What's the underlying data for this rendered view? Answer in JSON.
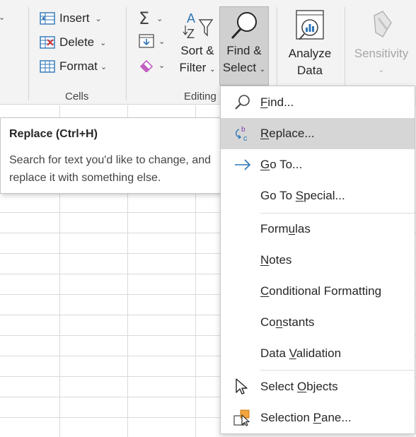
{
  "ribbon": {
    "cells_group": {
      "label": "Cells",
      "insert": "Insert",
      "delete": "Delete",
      "format": "Format"
    },
    "editing_group": {
      "label": "Editing",
      "autosum_icon": "sigma-icon",
      "fill_icon": "fill-down-icon",
      "clear_icon": "eraser-icon",
      "sort_filter_line1": "Sort &",
      "sort_filter_line2": "Filter",
      "find_select_line1": "Find &",
      "find_select_line2": "Select"
    },
    "analyze_data": {
      "line1": "Analyze",
      "line2": "Data"
    },
    "sensitivity": {
      "label": "Sensitivity"
    }
  },
  "tooltip": {
    "title": "Replace (Ctrl+H)",
    "body": "Search for text you'd like to change, and replace it with something else."
  },
  "menu": {
    "items": [
      {
        "pre": "",
        "u": "F",
        "post": "ind...",
        "icon": "search-icon"
      },
      {
        "pre": "",
        "u": "R",
        "post": "eplace...",
        "icon": "replace-icon"
      },
      {
        "pre": "",
        "u": "G",
        "post": "o To...",
        "icon": "arrow-right-icon"
      },
      {
        "pre": "Go To ",
        "u": "S",
        "post": "pecial...",
        "icon": ""
      },
      {
        "pre": "Form",
        "u": "u",
        "post": "las",
        "icon": ""
      },
      {
        "pre": "",
        "u": "N",
        "post": "otes",
        "icon": ""
      },
      {
        "pre": "",
        "u": "C",
        "post": "onditional Formatting",
        "icon": ""
      },
      {
        "pre": "Co",
        "u": "n",
        "post": "stants",
        "icon": ""
      },
      {
        "pre": "Data ",
        "u": "V",
        "post": "alidation",
        "icon": ""
      },
      {
        "pre": "Select ",
        "u": "O",
        "post": "bjects",
        "icon": "pointer-icon"
      },
      {
        "pre": "Selection ",
        "u": "P",
        "post": "ane...",
        "icon": "selection-pane-icon"
      }
    ]
  },
  "colors": {
    "accent_blue": "#2e75b6",
    "replace_purple": "#7a3fb0",
    "eraser_magenta": "#c05fc0",
    "delete_red": "#d13438",
    "selection_orange": "#f2a33a"
  }
}
